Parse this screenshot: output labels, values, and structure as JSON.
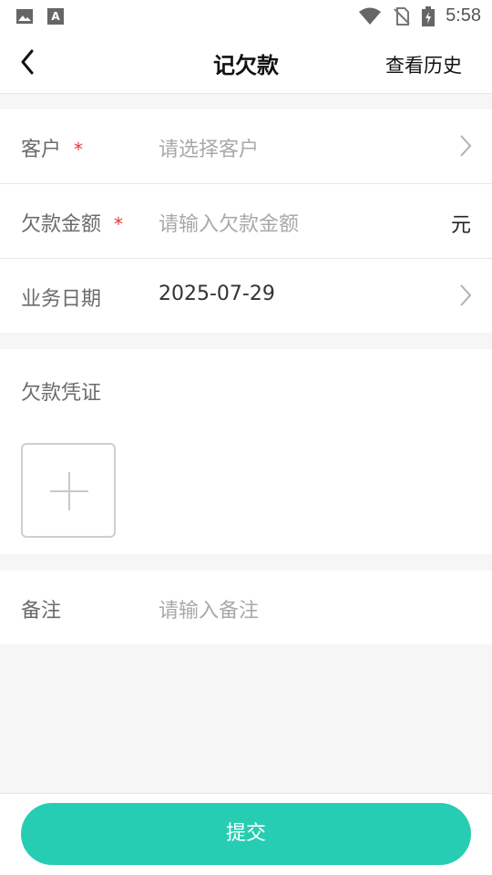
{
  "status_bar": {
    "time": "5:58",
    "left_icons": [
      "image-icon",
      "text-icon"
    ],
    "right_icons": [
      "wifi-icon",
      "no-sim-icon",
      "battery-charging-icon"
    ]
  },
  "nav": {
    "title": "记欠款",
    "right_action": "查看历史",
    "back_icon": "back-arrow-icon"
  },
  "form": {
    "customer": {
      "label": "客户",
      "required_mark": "*",
      "placeholder": "请选择客户"
    },
    "amount": {
      "label": "欠款金额",
      "required_mark": "*",
      "placeholder": "请输入欠款金额",
      "unit": "元"
    },
    "date": {
      "label": "业务日期",
      "value": "2025-07-29"
    },
    "voucher": {
      "label": "欠款凭证"
    },
    "note": {
      "label": "备注",
      "placeholder": "请输入备注"
    }
  },
  "submit_label": "提交",
  "colors": {
    "accent": "#27cdb2",
    "required": "#e53935",
    "placeholder": "#a9a9a9",
    "background": "#f6f6f6"
  }
}
